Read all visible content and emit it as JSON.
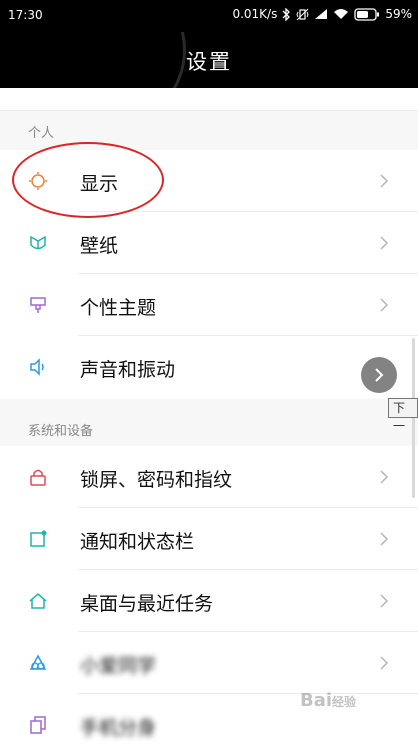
{
  "status_bar": {
    "time": "17:30",
    "network_speed": "0.01K/s",
    "battery_percent": "59%",
    "icons": [
      "bluetooth-icon",
      "vibrate-icon",
      "signal-icon",
      "wifi-icon",
      "battery-icon"
    ]
  },
  "header": {
    "title": "设置"
  },
  "sections": [
    {
      "title": "个人",
      "items": [
        {
          "label": "显示",
          "icon": "brightness-icon",
          "color": "#e8823a"
        },
        {
          "label": "壁纸",
          "icon": "wallpaper-icon",
          "color": "#1fb5a8"
        },
        {
          "label": "个性主题",
          "icon": "theme-icon",
          "color": "#9b6bd1"
        },
        {
          "label": "声音和振动",
          "icon": "sound-icon",
          "color": "#2f9be0"
        }
      ]
    },
    {
      "title": "系统和设备",
      "items": [
        {
          "label": "锁屏、密码和指纹",
          "icon": "lock-icon",
          "color": "#e04a5a"
        },
        {
          "label": "通知和状态栏",
          "icon": "notification-icon",
          "color": "#1fb5a8"
        },
        {
          "label": "桌面与最近任务",
          "icon": "home-icon",
          "color": "#1fb5a8"
        },
        {
          "label": "小爱同学",
          "icon": "assistant-icon",
          "color": "#2f9be0"
        },
        {
          "label": "手机分身",
          "icon": "dual-icon",
          "color": "#9b6bd1"
        }
      ]
    }
  ],
  "tooltip": {
    "label": "下一"
  },
  "watermark": {
    "text": "Bai",
    "subtext": "经验"
  }
}
